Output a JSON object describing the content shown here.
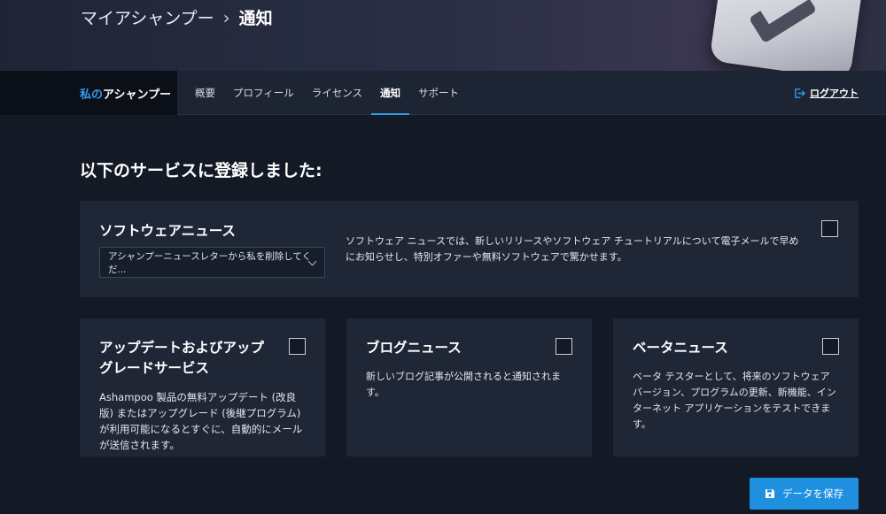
{
  "header": {
    "breadcrumb_root": "マイアシャンプー",
    "breadcrumb_sep": "›",
    "breadcrumb_current": "通知"
  },
  "nav": {
    "brand_accent": "私の",
    "brand_rest": "アシャンプー",
    "links": [
      {
        "label": "概要"
      },
      {
        "label": "プロフィール"
      },
      {
        "label": "ライセンス"
      },
      {
        "label": "通知",
        "active": true
      },
      {
        "label": "サポート"
      }
    ],
    "logout_label": "ログアウト"
  },
  "main": {
    "title": "以下のサービスに登録しました:",
    "software_news": {
      "title": "ソフトウェアニュース",
      "select_value": "アシャンプーニュースレターから私を削除してくだ...",
      "desc": "ソフトウェア ニュースでは、新しいリリースやソフトウェア チュートリアルについて電子メールで早めにお知らせし、特別オファーや無料ソフトウェアで驚かせます。",
      "checked": false
    },
    "updates": {
      "title": "アップデートおよびアップグレードサービス",
      "desc": "Ashampoo 製品の無料アップデート (改良版) またはアップグレード (後継プログラム) が利用可能になるとすぐに、自動的にメールが送信されます。",
      "checked": false
    },
    "blog": {
      "title": "ブログニュース",
      "desc": "新しいブログ記事が公開されると通知されます。",
      "checked": false
    },
    "beta": {
      "title": "ベータニュース",
      "desc": "ベータ テスターとして、将来のソフトウェア バージョン、プログラムの更新、新機能、インターネット アプリケーションをテストできます。",
      "checked": false
    },
    "save_label": "データを保存"
  },
  "colors": {
    "accent": "#2f9bea",
    "button": "#1f8fe0",
    "card": "#1f2737",
    "background": "#131a26"
  },
  "icons": {
    "logout": "logout-icon",
    "save": "save-floppy-icon",
    "dropdown": "chevron-down-icon"
  }
}
